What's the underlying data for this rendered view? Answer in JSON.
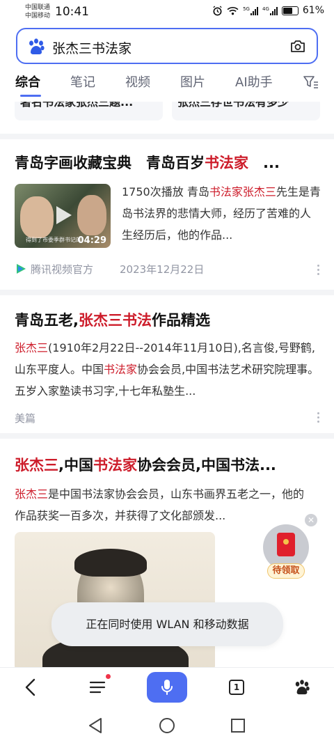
{
  "status_bar": {
    "carrier1": "中国联通",
    "carrier2": "中国移动",
    "time": "10:41",
    "signal1_label": "5G",
    "signal2_label": "4G",
    "battery": "61%"
  },
  "search": {
    "query": "张杰三书法家"
  },
  "tabs": [
    {
      "label": "综合",
      "active": true
    },
    {
      "label": "笔记"
    },
    {
      "label": "视频"
    },
    {
      "label": "图片"
    },
    {
      "label": "AI助手"
    }
  ],
  "chips": [
    "著名书法家张杰三题...",
    "张杰三存世书法有多少"
  ],
  "results": [
    {
      "title_pre": "青岛字画收藏宝典　青岛百岁",
      "title_hl": "书法家",
      "title_post": "　...",
      "views": "1750次播放",
      "snippet_a": "青岛",
      "snippet_hl": "书法家张杰三",
      "snippet_b": "先生是青岛书法界的悲情大师，经历了苦难的人生经历后，他的作品...",
      "duration": "04:29",
      "thumb_caption": "得到了市委季群书记的",
      "source": "腾讯视频官方",
      "date": "2023年12月22日"
    },
    {
      "title_pre": "青岛五老,",
      "title_hl": "张杰三书法",
      "title_post": "作品精选",
      "snippet_hl1": "张杰三",
      "snippet_a": "(1910年2月22日--2014年11月10日),名言俊,号野鹤,山东平度人。中国",
      "snippet_hl2": "书法家",
      "snippet_b": "协会会员,中国书法艺术研究院理事。 五岁入家塾读书习字,十七年私塾生...",
      "source": "美篇"
    },
    {
      "title_hl1": "张杰三",
      "title_a": ",中国",
      "title_hl2": "书法家",
      "title_b": "协会会员,中国书法...",
      "snippet_hl": "张杰三",
      "snippet_b": "是中国书法家协会会员，山东书画界五老之一，他的作品获奖一百多次，并获得了文化部颁发..."
    }
  ],
  "red_packet": {
    "label": "待领取"
  },
  "toast": "正在同时使用 WLAN 和移动数据",
  "toolbar": {
    "tab_count": "1"
  },
  "colors": {
    "accent": "#4e6ef2",
    "highlight": "#cd1c2a"
  }
}
